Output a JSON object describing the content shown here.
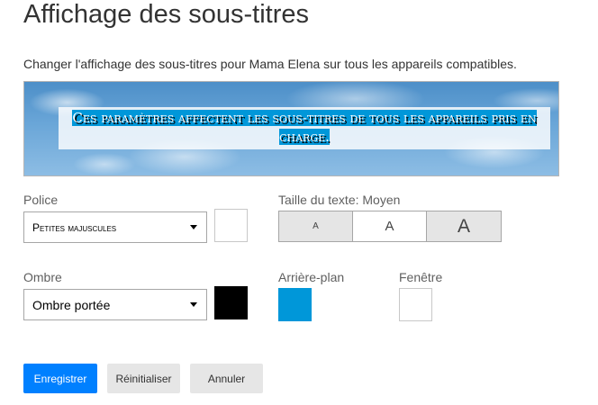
{
  "page": {
    "title": "Affichage des sous-titres",
    "description": "Changer l'affichage des sous-titres pour Mama Elena sur tous les appareils compatibles."
  },
  "preview": {
    "text": "Ces paramètres affectent les sous-titres de tous les appareils pris en charge."
  },
  "font": {
    "label": "Police",
    "selected": "Petites majuscules",
    "color": "#ffffff"
  },
  "text_size": {
    "label": "Taille du texte: Moyen",
    "options": [
      "A",
      "A",
      "A"
    ],
    "selected_index": 1
  },
  "shadow": {
    "label": "Ombre",
    "selected": "Ombre portée",
    "color": "#000000"
  },
  "background": {
    "label": "Arrière-plan",
    "color": "#0097d9"
  },
  "window": {
    "label": "Fenêtre",
    "color": "#ffffff"
  },
  "actions": {
    "save": "Enregistrer",
    "reset": "Réinitialiser",
    "cancel": "Annuler"
  },
  "colors": {
    "accent": "#0080ff",
    "subtitle_background": "#0097d9"
  }
}
